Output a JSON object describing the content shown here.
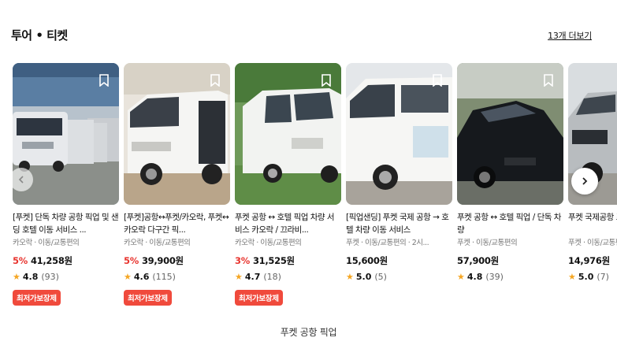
{
  "section": {
    "title": "투어 • 티켓",
    "more_label": "13개 더보기"
  },
  "cards": [
    {
      "name": "[푸켓] 단독 차량 공항 픽업 및 샌딩 호텔 이동 서비스 ...",
      "sub": "카오락 · 이동/교통편의",
      "discount": "5%",
      "price": "41,258원",
      "rating": "4.8",
      "count": "(93)",
      "badge": "최저가보장제"
    },
    {
      "name": "[푸켓]공항↔푸켓/카오락, 푸켓↔카오락 다구간 픽...",
      "sub": "카오락 · 이동/교통편의",
      "discount": "5%",
      "price": "39,900원",
      "rating": "4.6",
      "count": "(115)",
      "badge": "최저가보장제"
    },
    {
      "name": "푸켓 공항 ↔ 호텔 픽업 차량 서비스 카오락 / 끄라비...",
      "sub": "카오락 · 이동/교통편의",
      "discount": "3%",
      "price": "31,525원",
      "rating": "4.7",
      "count": "(18)",
      "badge": "최저가보장제"
    },
    {
      "name": "[픽업샌딩] 푸켓 국제 공항 → 호텔 차량 이동 서비스",
      "sub": "푸켓 · 이동/교통편의 · 2시...",
      "discount": "",
      "price": "15,600원",
      "rating": "5.0",
      "count": "(5)",
      "badge": ""
    },
    {
      "name": "푸켓 공항 ↔ 호텔 픽업 / 단독 차량",
      "sub": "푸켓 · 이동/교통편의",
      "discount": "",
      "price": "57,900원",
      "rating": "4.8",
      "count": "(39)",
      "badge": ""
    },
    {
      "name": "푸켓 국제공항 프라이빗 픽...",
      "sub": "푸켓 · 이동/교통편의",
      "discount": "",
      "price": "14,976원",
      "rating": "5.0",
      "count": "(7)",
      "badge": ""
    }
  ],
  "caption": "푸켓 공항 픽업",
  "icons": {
    "bookmark": "bookmark-icon",
    "prev": "chevron-left-icon",
    "next": "chevron-right-icon",
    "star": "star-icon"
  },
  "colors": {
    "discount": "#e8352f",
    "badge": "#f04a3c",
    "star": "#f5a623"
  }
}
